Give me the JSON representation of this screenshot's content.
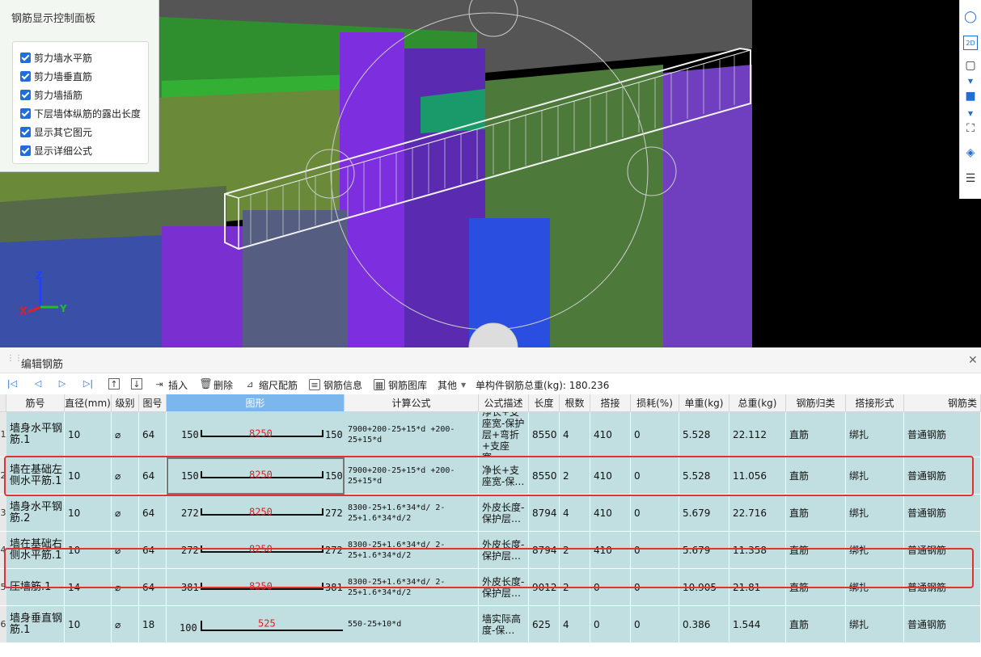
{
  "control_panel": {
    "title": "钢筋显示控制面板",
    "options": [
      {
        "label": "剪力墙水平筋",
        "checked": true
      },
      {
        "label": "剪力墙垂直筋",
        "checked": true
      },
      {
        "label": "剪力墙插筋",
        "checked": true
      },
      {
        "label": "下层墙体纵筋的露出长度",
        "checked": true
      },
      {
        "label": "显示其它图元",
        "checked": true
      },
      {
        "label": "显示详细公式",
        "checked": true
      }
    ]
  },
  "viewport": {
    "axis": {
      "x": "X",
      "y": "Y",
      "z": "Z"
    },
    "right_toolbar": [
      "orbit-icon",
      "2d-view-icon",
      "cube-view-icon",
      "cube-solid-icon",
      "fit-view-icon",
      "section-icon",
      "layers-icon"
    ],
    "right_toolbar_text": {
      "2d": "2D"
    }
  },
  "panel": {
    "title": "编辑钢筋",
    "toolbar": {
      "insert": "插入",
      "delete": "删除",
      "scale_rebar": "缩尺配筋",
      "rebar_info": "钢筋信息",
      "rebar_library": "钢筋图库",
      "other": "其他",
      "total_weight": "单构件钢筋总重(kg): 180.236"
    },
    "columns": [
      "筋号",
      "直径(mm)",
      "级别",
      "图号",
      "图形",
      "计算公式",
      "公式描述",
      "长度",
      "根数",
      "搭接",
      "损耗(%)",
      "单重(kg)",
      "总重(kg)",
      "钢筋归类",
      "搭接形式",
      "钢筋类"
    ],
    "rows": [
      {
        "num": "1",
        "name": "墙身水平钢筋.1",
        "dia": "10",
        "grade": "⌀",
        "fig": "64",
        "l": "150",
        "m": "8250",
        "r": "150",
        "formula": "7900+200-25+15*d +200-25+15*d",
        "desc": "净长+支座宽-保护层+弯折+支座宽…",
        "len": "8550",
        "count": "4",
        "lap": "410",
        "loss": "0",
        "unit": "5.528",
        "total": "22.112",
        "cls": "直筋",
        "lapform": "绑扎",
        "type": "普通钢筋"
      },
      {
        "num": "2",
        "name": "墙在基础左侧水平筋.1",
        "dia": "10",
        "grade": "⌀",
        "fig": "64",
        "l": "150",
        "m": "8250",
        "r": "150",
        "formula": "7900+200-25+15*d +200-25+15*d",
        "desc": "净长+支座宽-保…",
        "len": "8550",
        "count": "2",
        "lap": "410",
        "loss": "0",
        "unit": "5.528",
        "total": "11.056",
        "cls": "直筋",
        "lapform": "绑扎",
        "type": "普通钢筋"
      },
      {
        "num": "3",
        "name": "墙身水平钢筋.2",
        "dia": "10",
        "grade": "⌀",
        "fig": "64",
        "l": "272",
        "m": "8250",
        "r": "272",
        "formula": "8300-25+1.6*34*d/ 2-25+1.6*34*d/2",
        "desc": "外皮长度-保护层…",
        "len": "8794",
        "count": "4",
        "lap": "410",
        "loss": "0",
        "unit": "5.679",
        "total": "22.716",
        "cls": "直筋",
        "lapform": "绑扎",
        "type": "普通钢筋"
      },
      {
        "num": "4",
        "name": "墙在基础右侧水平筋.1",
        "dia": "10",
        "grade": "⌀",
        "fig": "64",
        "l": "272",
        "m": "8250",
        "r": "272",
        "formula": "8300-25+1.6*34*d/ 2-25+1.6*34*d/2",
        "desc": "外皮长度-保护层…",
        "len": "8794",
        "count": "2",
        "lap": "410",
        "loss": "0",
        "unit": "5.679",
        "total": "11.358",
        "cls": "直筋",
        "lapform": "绑扎",
        "type": "普通钢筋"
      },
      {
        "num": "5",
        "name": "压墙筋.1",
        "dia": "14",
        "grade": "⌀",
        "fig": "64",
        "l": "381",
        "m": "8250",
        "r": "381",
        "formula": "8300-25+1.6*34*d/ 2-25+1.6*34*d/2",
        "desc": "外皮长度-保护层…",
        "len": "9012",
        "count": "2",
        "lap": "0",
        "loss": "0",
        "unit": "10.905",
        "total": "21.81",
        "cls": "直筋",
        "lapform": "绑扎",
        "type": "普通钢筋"
      },
      {
        "num": "6",
        "name": "墙身垂直钢筋.1",
        "dia": "10",
        "grade": "⌀",
        "fig": "18",
        "l": "100",
        "m": "525",
        "r": "",
        "formula": "550-25+10*d",
        "desc": "墙实际高度-保…",
        "len": "625",
        "count": "4",
        "lap": "0",
        "loss": "0",
        "unit": "0.386",
        "total": "1.544",
        "cls": "直筋",
        "lapform": "绑扎",
        "type": "普通钢筋"
      }
    ]
  }
}
